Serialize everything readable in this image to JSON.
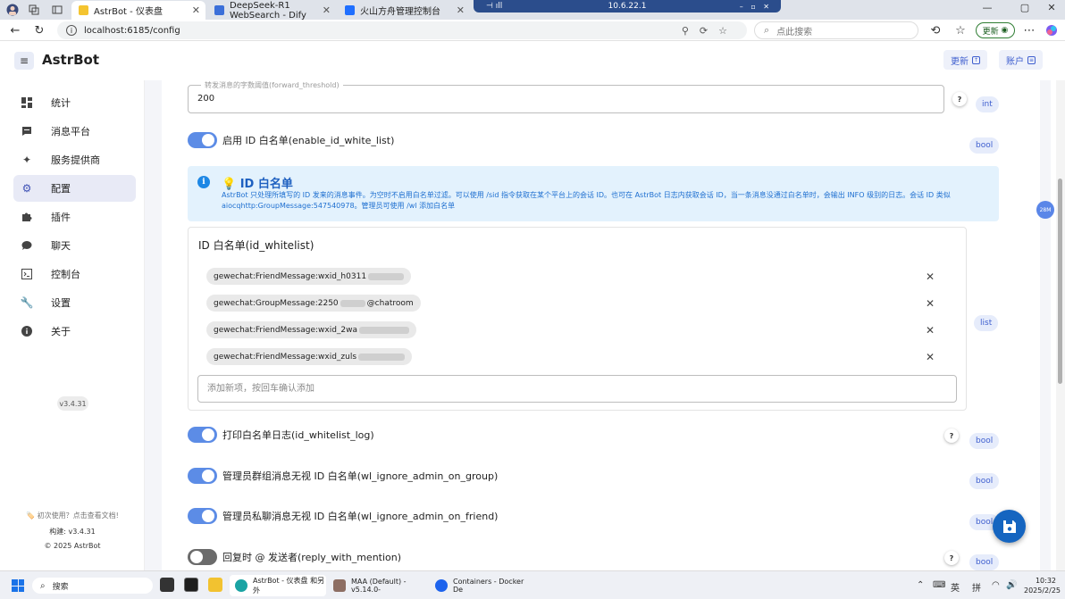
{
  "browser": {
    "tabs": [
      {
        "title": "AstrBot - 仪表盘",
        "active": true,
        "color": "#f4c430"
      },
      {
        "title": "DeepSeek-R1 WebSearch - Dify",
        "active": false,
        "color": "#3b6fd9"
      },
      {
        "title": "火山方舟管理控制台",
        "active": false,
        "color": "#1f6fff"
      }
    ],
    "remote_host": "10.6.22.1",
    "url": "localhost:6185/config",
    "search_placeholder": "点此搜索",
    "update_label": "更新"
  },
  "app": {
    "brand": "AstrBot",
    "header_buttons": {
      "update": "更新",
      "account": "账户"
    },
    "version_chip": "v3.4.31",
    "accent": "#5c8ce6"
  },
  "sidebar": {
    "items": [
      {
        "label": "统计",
        "icon": "dashboard-icon",
        "active": false
      },
      {
        "label": "消息平台",
        "icon": "message-icon",
        "active": false
      },
      {
        "label": "服务提供商",
        "icon": "sparkle-icon",
        "active": false
      },
      {
        "label": "配置",
        "icon": "gear-icon",
        "active": true
      },
      {
        "label": "插件",
        "icon": "puzzle-icon",
        "active": false
      },
      {
        "label": "聊天",
        "icon": "chat-icon",
        "active": false
      },
      {
        "label": "控制台",
        "icon": "console-icon",
        "active": false
      },
      {
        "label": "设置",
        "icon": "wrench-icon",
        "active": false
      },
      {
        "label": "关于",
        "icon": "info-icon",
        "active": false
      }
    ],
    "footer": {
      "docs": "初次使用？点击查看文档!",
      "build": "构建: v3.4.31",
      "copyright": "© 2025 AstrBot"
    }
  },
  "config": {
    "forward_threshold": {
      "label": "转发消息的字数阈值(forward_threshold)",
      "value": "200",
      "type": "int"
    },
    "enable_id_white_list": {
      "label": "启用 ID 白名单(enable_id_white_list)",
      "on": true,
      "type": "bool"
    },
    "alert": {
      "title": "💡 ID 白名单",
      "text": "AstrBot 只处理所填写的 ID 发来的消息事件。为空时不启用白名单过滤。可以使用 /sid 指令获取在某个平台上的会话 ID。也可在 AstrBot 日志内获取会话 ID，当一条消息没通过白名单时，会输出 INFO 级别的日志。会话 ID 类似 aiocqhttp:GroupMessage:547540978。管理员可使用 /wl 添加白名单"
    },
    "id_whitelist": {
      "title": "ID 白名单(id_whitelist)",
      "type": "list",
      "entries": [
        {
          "prefix": "gewechat:FriendMessage:wxid_h0311",
          "suffix": ""
        },
        {
          "prefix": "gewechat:GroupMessage:2250",
          "suffix": "@chatroom"
        },
        {
          "prefix": "gewechat:FriendMessage:wxid_2wa",
          "suffix": ""
        },
        {
          "prefix": "gewechat:FriendMessage:wxid_zuls",
          "suffix": ""
        }
      ],
      "add_placeholder": "添加新项，按回车确认添加"
    },
    "id_whitelist_log": {
      "label": "打印白名单日志(id_whitelist_log)",
      "on": true,
      "type": "bool"
    },
    "wl_ignore_admin_on_group": {
      "label": "管理员群组消息无视 ID 白名单(wl_ignore_admin_on_group)",
      "on": true,
      "type": "bool"
    },
    "wl_ignore_admin_on_friend": {
      "label": "管理员私聊消息无视 ID 白名单(wl_ignore_admin_on_friend)",
      "on": true,
      "type": "bool"
    },
    "reply_with_mention": {
      "label": "回复时 @ 发送者(reply_with_mention)",
      "on": false,
      "type": "bool"
    }
  },
  "float_badge": "28M",
  "taskbar": {
    "search": "搜索",
    "windows": [
      {
        "title": "AstrBot - 仪表盘 和另外",
        "active": true
      },
      {
        "title": "MAA (Default) - v5.14.0-",
        "active": false
      },
      {
        "title": "Containers - Docker De",
        "active": false
      }
    ],
    "ime": [
      "英",
      "拼"
    ],
    "time": "10:32",
    "date": "2025/2/25"
  }
}
